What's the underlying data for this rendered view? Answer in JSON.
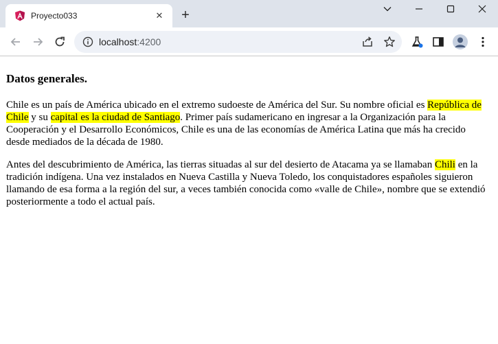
{
  "browser": {
    "tab": {
      "title": "Proyecto033",
      "close_label": "✕"
    },
    "new_tab_label": "+",
    "address": {
      "host": "localhost",
      "port": ":4200"
    }
  },
  "content": {
    "heading": "Datos generales.",
    "paragraph1": {
      "t1": "Chile es un país de América ubicado en el extremo sudoeste de América del Sur. Su nombre oficial es ",
      "h1": "República de Chile",
      "t2": " y su ",
      "h2": "capital es la ciudad de Santiago",
      "t3": ". Primer país sudamericano en ingresar a la Organización para la Cooperación y el Desarrollo Económicos, Chile es una de las economías de América Latina que más ha crecido desde mediados de la década de 1980."
    },
    "paragraph2": {
      "t1": "Antes del descubrimiento de América, las tierras situadas al sur del desierto de Atacama ya se llamaban ",
      "h1": "Chili",
      "t2": " en la tradición indígena. Una vez instalados en Nueva Castilla y Nueva Toledo, los conquistadores españoles siguieron llamando de esa forma a la región del sur, a veces también conocida como «valle de Chile», nombre que se extendió posteriormente a todo el actual país."
    }
  },
  "colors": {
    "highlight": "#ffff00",
    "tabstrip": "#dee3eb",
    "omnibox": "#eef1f7"
  },
  "icons": [
    "angular-favicon-icon",
    "tab-close-icon",
    "new-tab-icon",
    "chevron-down-icon",
    "minimize-icon",
    "maximize-icon",
    "window-close-icon",
    "back-arrow-icon",
    "forward-arrow-icon",
    "reload-icon",
    "site-info-icon",
    "share-icon",
    "bookmark-star-icon",
    "labs-flask-icon",
    "side-panel-icon",
    "profile-avatar-icon",
    "menu-dots-icon"
  ]
}
